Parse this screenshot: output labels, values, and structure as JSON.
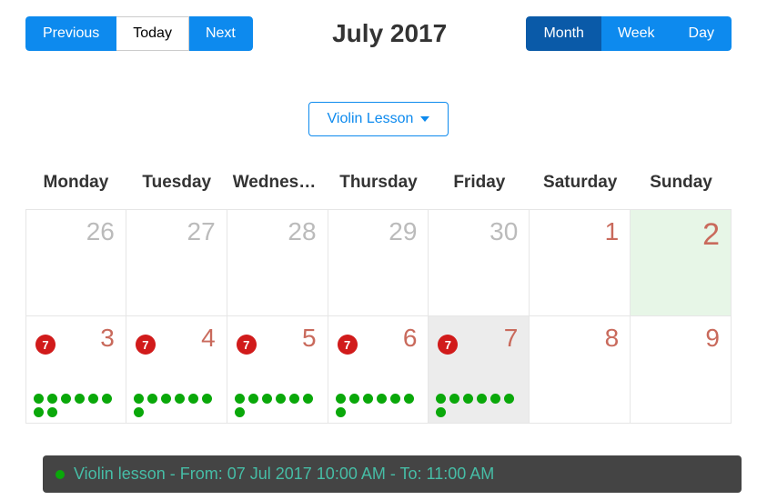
{
  "nav": {
    "previous": "Previous",
    "today": "Today",
    "next": "Next"
  },
  "title": "July 2017",
  "views": {
    "month": "Month",
    "week": "Week",
    "day": "Day",
    "active": "month"
  },
  "filter": {
    "label": "Violin Lesson"
  },
  "day_headers": [
    "Monday",
    "Tuesday",
    "Wednesd…",
    "Thursday",
    "Friday",
    "Saturday",
    "Sunday"
  ],
  "weeks": [
    {
      "days": [
        {
          "num": "26",
          "in_month": false,
          "today": false,
          "hover": false,
          "badge": null,
          "dots": 0
        },
        {
          "num": "27",
          "in_month": false,
          "today": false,
          "hover": false,
          "badge": null,
          "dots": 0
        },
        {
          "num": "28",
          "in_month": false,
          "today": false,
          "hover": false,
          "badge": null,
          "dots": 0
        },
        {
          "num": "29",
          "in_month": false,
          "today": false,
          "hover": false,
          "badge": null,
          "dots": 0
        },
        {
          "num": "30",
          "in_month": false,
          "today": false,
          "hover": false,
          "badge": null,
          "dots": 0
        },
        {
          "num": "1",
          "in_month": true,
          "today": false,
          "hover": false,
          "badge": null,
          "dots": 0
        },
        {
          "num": "2",
          "in_month": true,
          "today": true,
          "hover": false,
          "badge": null,
          "dots": 0
        }
      ]
    },
    {
      "days": [
        {
          "num": "3",
          "in_month": true,
          "today": false,
          "hover": false,
          "badge": "7",
          "dots": 8
        },
        {
          "num": "4",
          "in_month": true,
          "today": false,
          "hover": false,
          "badge": "7",
          "dots": 7
        },
        {
          "num": "5",
          "in_month": true,
          "today": false,
          "hover": false,
          "badge": "7",
          "dots": 7
        },
        {
          "num": "6",
          "in_month": true,
          "today": false,
          "hover": false,
          "badge": "7",
          "dots": 7
        },
        {
          "num": "7",
          "in_month": true,
          "today": false,
          "hover": true,
          "badge": "7",
          "dots": 7
        },
        {
          "num": "8",
          "in_month": true,
          "today": false,
          "hover": false,
          "badge": null,
          "dots": 0
        },
        {
          "num": "9",
          "in_month": true,
          "today": false,
          "hover": false,
          "badge": null,
          "dots": 0
        }
      ]
    }
  ],
  "tooltip": {
    "text": "Violin lesson - From: 07 Jul 2017 10:00 AM - To: 11:00 AM"
  }
}
